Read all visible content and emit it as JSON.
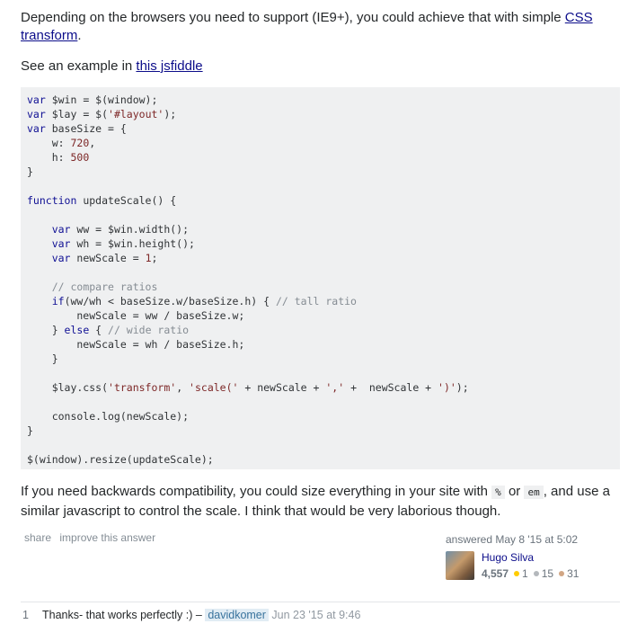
{
  "answer": {
    "intro": {
      "text_before": "Depending on the browsers you need to support (IE9+), you could achieve that with simple ",
      "link": "CSS transform",
      "text_after": "."
    },
    "example": {
      "text_before": "See an example in ",
      "link": "this jsfiddle"
    },
    "code": [
      [
        [
          "kw",
          "var"
        ],
        [
          "p",
          " $win = $(window);"
        ]
      ],
      [
        [
          "kw",
          "var"
        ],
        [
          "p",
          " $lay = $("
        ],
        [
          "str",
          "'#layout'"
        ],
        [
          "p",
          ");"
        ]
      ],
      [
        [
          "kw",
          "var"
        ],
        [
          "p",
          " baseSize = {"
        ]
      ],
      [
        [
          "p",
          "    w: "
        ],
        [
          "num",
          "720"
        ],
        [
          "p",
          ","
        ]
      ],
      [
        [
          "p",
          "    h: "
        ],
        [
          "num",
          "500"
        ]
      ],
      [
        [
          "p",
          "}"
        ]
      ],
      [],
      [
        [
          "kw",
          "function"
        ],
        [
          "p",
          " updateScale() {"
        ]
      ],
      [],
      [
        [
          "p",
          "    "
        ],
        [
          "kw",
          "var"
        ],
        [
          "p",
          " ww = $win.width();"
        ]
      ],
      [
        [
          "p",
          "    "
        ],
        [
          "kw",
          "var"
        ],
        [
          "p",
          " wh = $win.height();"
        ]
      ],
      [
        [
          "p",
          "    "
        ],
        [
          "kw",
          "var"
        ],
        [
          "p",
          " newScale = "
        ],
        [
          "num",
          "1"
        ],
        [
          "p",
          ";"
        ]
      ],
      [],
      [
        [
          "p",
          "    "
        ],
        [
          "com",
          "// compare ratios"
        ]
      ],
      [
        [
          "p",
          "    "
        ],
        [
          "kw",
          "if"
        ],
        [
          "p",
          "(ww/wh < baseSize.w/baseSize.h) { "
        ],
        [
          "com",
          "// tall ratio"
        ]
      ],
      [
        [
          "p",
          "        newScale = ww / baseSize.w;"
        ]
      ],
      [
        [
          "p",
          "    } "
        ],
        [
          "kw",
          "else"
        ],
        [
          "p",
          " { "
        ],
        [
          "com",
          "// wide ratio"
        ]
      ],
      [
        [
          "p",
          "        newScale = wh / baseSize.h;"
        ]
      ],
      [
        [
          "p",
          "    }"
        ]
      ],
      [],
      [
        [
          "p",
          "    $lay.css("
        ],
        [
          "str",
          "'transform'"
        ],
        [
          "p",
          ", "
        ],
        [
          "str",
          "'scale('"
        ],
        [
          "p",
          " + newScale + "
        ],
        [
          "str",
          "','"
        ],
        [
          "p",
          " +  newScale + "
        ],
        [
          "str",
          "')'"
        ],
        [
          "p",
          ");"
        ]
      ],
      [],
      [
        [
          "p",
          "    console.log(newScale);"
        ]
      ],
      [
        [
          "p",
          "}"
        ]
      ],
      [],
      [
        [
          "p",
          "$(window).resize(updateScale);"
        ]
      ]
    ],
    "after": {
      "text1": "If you need backwards compatibility, you could size everything in your site with ",
      "code1": "%",
      "text2": " or ",
      "code2": "em",
      "text3": ", and use a similar javascript to control the scale. I think that would be very laborious though."
    }
  },
  "post_menu": {
    "share": "share",
    "improve": "improve this answer"
  },
  "signature": {
    "action_time": "answered May 8 '15 at 5:02",
    "user_name": "Hugo Silva",
    "reputation": "4,557",
    "gold": "1",
    "silver": "15",
    "bronze": "31"
  },
  "colors": {
    "gold": "#ffcc01",
    "silver": "#b4b8bc",
    "bronze": "#d1a684"
  },
  "comments": [
    {
      "score": "1",
      "text": "Thanks- that works perfectly :) – ",
      "user": "davidkomer",
      "date": "Jun 23 '15 at 9:46"
    }
  ]
}
